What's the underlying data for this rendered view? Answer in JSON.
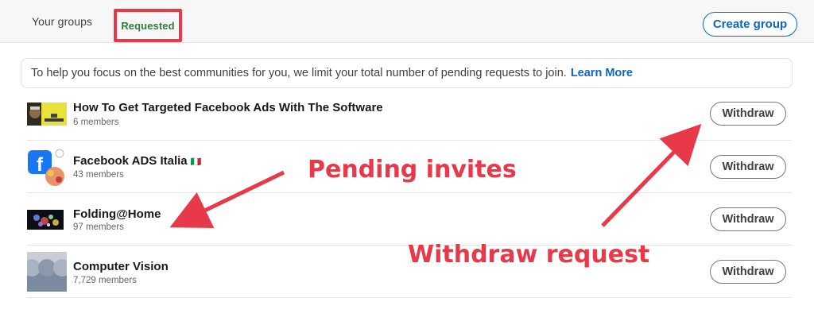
{
  "tabs": {
    "your_groups": "Your groups",
    "requested": "Requested"
  },
  "create_group_label": "Create group",
  "notice": {
    "text": "To help you focus on the best communities for you, we limit your total number of pending requests to join.",
    "link": "Learn More"
  },
  "groups": [
    {
      "name": "How To Get Targeted Facebook Ads With The Software",
      "members": "6 members",
      "action": "Withdraw"
    },
    {
      "name": "Facebook ADS Italia",
      "flag": "🇮🇹",
      "members": "43 members",
      "action": "Withdraw"
    },
    {
      "name": "Folding@Home",
      "members": "97 members",
      "action": "Withdraw"
    },
    {
      "name": "Computer Vision",
      "members": "7,729 members",
      "action": "Withdraw"
    }
  ],
  "annotations": {
    "pending": "Pending invites",
    "withdraw": "Withdraw request"
  },
  "colors": {
    "accent": "#0a66c2",
    "annotation_red": "#e8394a",
    "requested_green": "#2f7d3b"
  }
}
